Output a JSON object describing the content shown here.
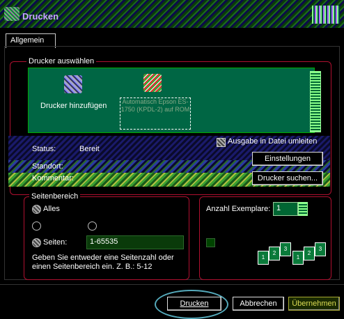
{
  "window": {
    "title": "Drucken"
  },
  "tabs": [
    {
      "label": "Allgemein"
    }
  ],
  "printer_select": {
    "group_label": "Drucker auswählen",
    "add_printer_label": "Drucker hinzufügen",
    "selected_printer_label": "Automatisch Epson ES-1750 (KPDL-2) auf ROM"
  },
  "status": {
    "status_label": "Status:",
    "status_value": "Bereit",
    "location_label": "Standort:",
    "comment_label": "Kommentar:",
    "print_to_file_label": "Ausgabe in Datei umleiten",
    "settings_button": "Einstellungen",
    "find_printer_button": "Drucker suchen..."
  },
  "page_range": {
    "group_label": "Seitenbereich",
    "all_label": "Alles",
    "pages_label": "Seiten:",
    "pages_value": "1-65535",
    "hint": "Geben Sie entweder eine Seitenzahl oder einen Seitenbereich ein. Z. B.: 5-12"
  },
  "copies": {
    "label": "Anzahl Exemplare:",
    "value": "1",
    "collate_pages": [
      "1",
      "2",
      "3"
    ]
  },
  "buttons": {
    "print": "Drucken",
    "cancel": "Abbrechen",
    "apply": "Übernehmen"
  }
}
